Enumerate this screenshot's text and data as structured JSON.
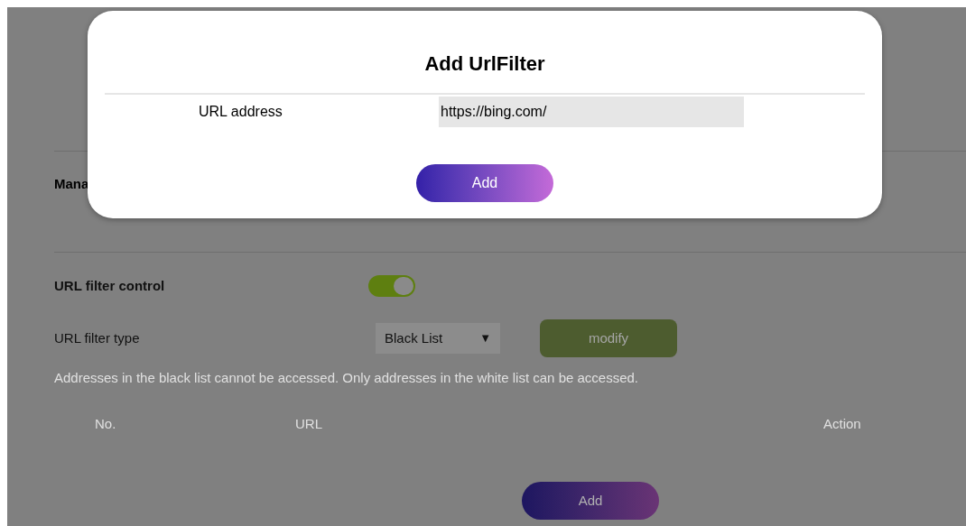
{
  "dialog": {
    "title": "Add UrlFilter",
    "field_label": "URL address",
    "field_value": "https://bing.com/",
    "button": "Add"
  },
  "page": {
    "section_title": "Mana",
    "filter_control": {
      "label": "URL filter control",
      "on": true
    },
    "filter_type": {
      "label": "URL filter type",
      "value": "Black List",
      "caret": "▼",
      "button": "modify"
    },
    "note": "Addresses in the black list cannot be accessed. Only addresses in the white list can be accessed.",
    "table": {
      "columns": [
        "No.",
        "URL",
        "Action"
      ]
    },
    "add_button": "Add"
  }
}
